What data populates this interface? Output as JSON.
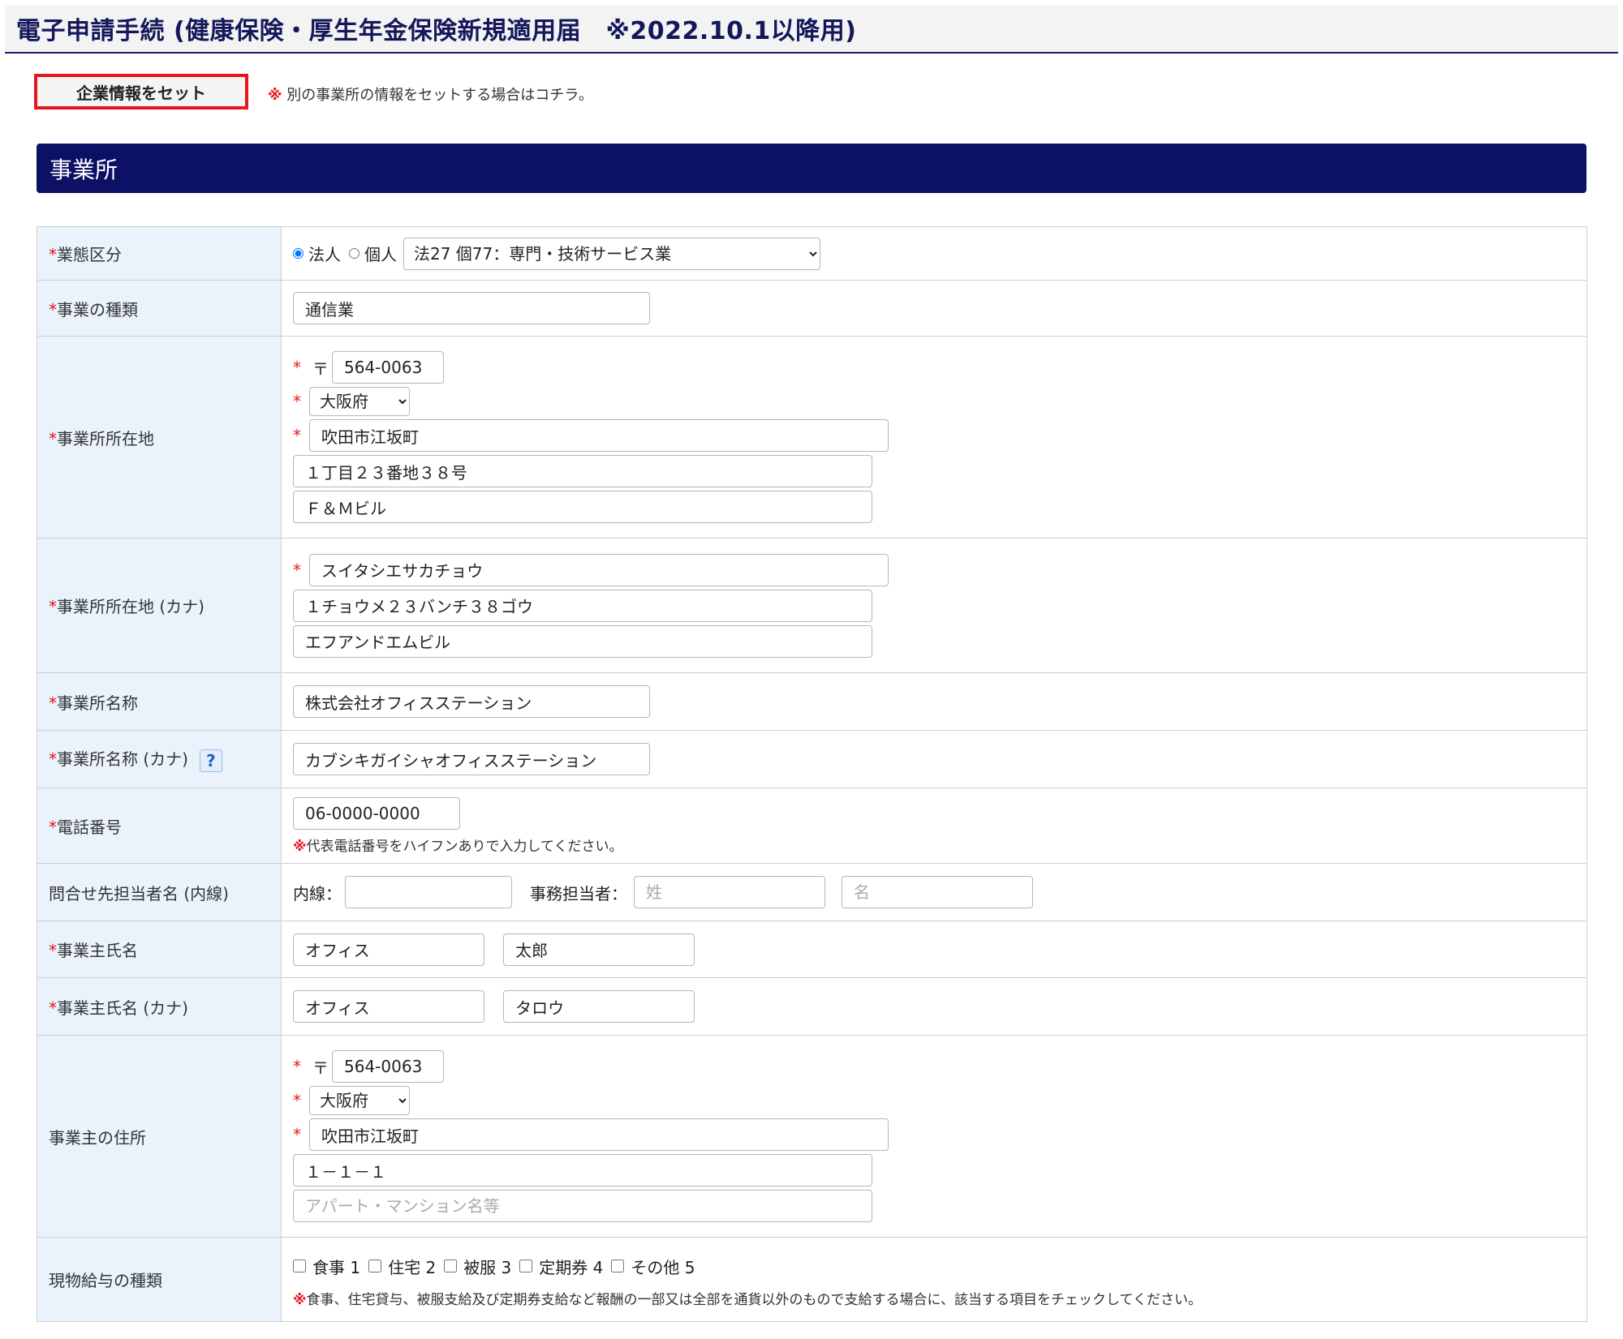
{
  "header": {
    "title": "電子申請手続 (健康保険・厚生年金保険新規適用届　※2022.10.1以降用)"
  },
  "toolbar": {
    "set_label": "企業情報をセット",
    "note_mark": "※",
    "note_text": "別の事業所の情報をセットする場合はコチラ。"
  },
  "section": {
    "title": "事業所"
  },
  "common": {
    "required_star": "*",
    "note_mark": "※",
    "postal_mark": "〒"
  },
  "rows": {
    "business_type": {
      "label": "業態区分",
      "radio_corporate": "法人",
      "radio_individual": "個人",
      "selected_radio": "法人",
      "industry_selected": "法27 個77：専門・技術サービス業"
    },
    "business_kind": {
      "label": "事業の種類",
      "value": "通信業"
    },
    "office_address": {
      "label": "事業所所在地",
      "postal": "564-0063",
      "prefecture": "大阪府",
      "city": "吹田市江坂町",
      "line1": "１丁目２３番地３８号",
      "line2": "Ｆ＆Ｍビル"
    },
    "office_address_kana": {
      "label": "事業所所在地 (カナ)",
      "city": "スイタシエサカチョウ",
      "line1": "１チョウメ２３バンチ３８ゴウ",
      "line2": "エフアンドエムビル"
    },
    "office_name": {
      "label": "事業所名称",
      "value": "株式会社オフィスステーション"
    },
    "office_name_kana": {
      "label": "事業所名称 (カナ)",
      "help_glyph": "?",
      "value": "カブシキガイシャオフィスステーション"
    },
    "phone": {
      "label": "電話番号",
      "value": "06-0000-0000",
      "hint": "代表電話番号をハイフンありで入力してください。"
    },
    "contact": {
      "label": "問合せ先担当者名 (内線)",
      "ext_label": "内線：",
      "ext_value": "",
      "staff_label": "事務担当者：",
      "last_placeholder": "姓",
      "first_placeholder": "名"
    },
    "owner_name": {
      "label": "事業主氏名",
      "last": "オフィス",
      "first": "太郎"
    },
    "owner_name_kana": {
      "label": "事業主氏名 (カナ)",
      "last": "オフィス",
      "first": "タロウ"
    },
    "owner_address": {
      "label": "事業主の住所",
      "postal": "564-0063",
      "prefecture": "大阪府",
      "city": "吹田市江坂町",
      "line1": "１－１－１",
      "line2_placeholder": "アパート・マンション名等"
    },
    "in_kind": {
      "label": "現物給与の種類",
      "options": [
        "食事 1",
        "住宅 2",
        "被服 3",
        "定期券 4",
        "その他 5"
      ],
      "hint": "食事、住宅貸与、被服支給及び定期券支給など報酬の一部又は全部を通貨以外のもので支給する場合に、該当する項目をチェックしてください。"
    }
  }
}
